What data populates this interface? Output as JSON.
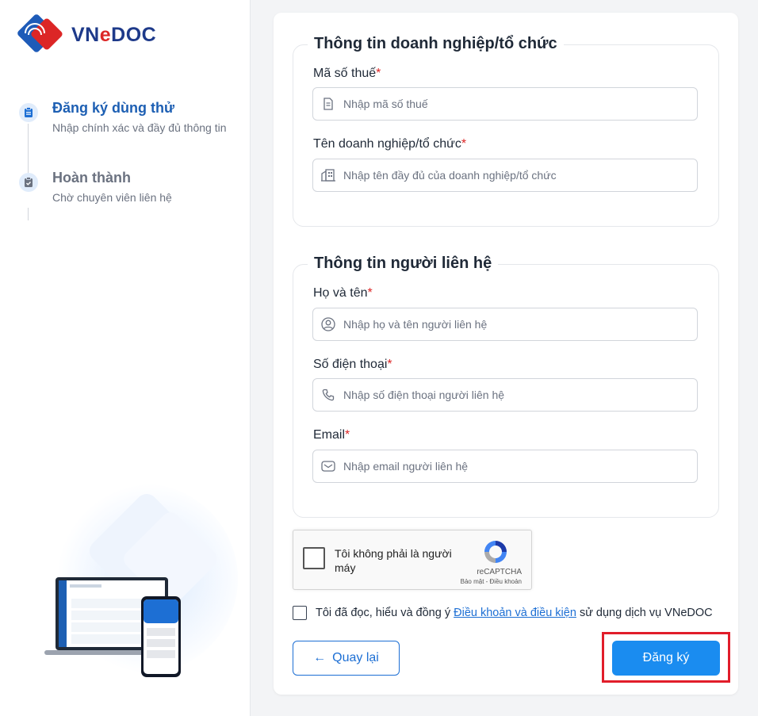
{
  "brand": {
    "name_prefix": "VN",
    "name_e": "e",
    "name_suffix": "DOC"
  },
  "steps": [
    {
      "title": "Đăng ký dùng thử",
      "subtitle": "Nhập chính xác và đầy đủ thông tin",
      "active": true
    },
    {
      "title": "Hoàn thành",
      "subtitle": "Chờ chuyên viên liên hệ",
      "active": false
    }
  ],
  "business_section": {
    "legend": "Thông tin doanh nghiệp/tổ chức",
    "tax_code": {
      "label": "Mã số thuế",
      "required_mark": "*",
      "placeholder": "Nhập mã số thuế",
      "value": ""
    },
    "company_name": {
      "label": "Tên doanh nghiệp/tổ chức",
      "required_mark": "*",
      "placeholder": "Nhập tên đầy đủ của doanh nghiệp/tổ chức",
      "value": ""
    }
  },
  "contact_section": {
    "legend": "Thông tin người liên hệ",
    "full_name": {
      "label": "Họ và tên",
      "required_mark": "*",
      "placeholder": "Nhập họ và tên người liên hệ",
      "value": ""
    },
    "phone": {
      "label": "Số điện thoại",
      "required_mark": "*",
      "placeholder": "Nhập số điện thoại người liên hệ",
      "value": ""
    },
    "email": {
      "label": "Email",
      "required_mark": "*",
      "placeholder": "Nhập email người liên hệ",
      "value": ""
    }
  },
  "recaptcha": {
    "text": "Tôi không phải là người máy",
    "brand": "reCAPTCHA",
    "links": "Bảo mật - Điều khoản"
  },
  "agreement": {
    "prefix": "Tôi đã đọc, hiểu và đồng ý",
    "link": "Điều khoản và điều kiện",
    "suffix": "sử dụng dịch vụ VNeDOC",
    "checked": false
  },
  "buttons": {
    "back_arrow": "←",
    "back_label": "Quay lại",
    "submit_label": "Đăng ký"
  },
  "colors": {
    "primary": "#1a8cf0",
    "brand_blue": "#1e3a8a",
    "brand_red": "#dc2626",
    "highlight": "#e11d2a"
  }
}
